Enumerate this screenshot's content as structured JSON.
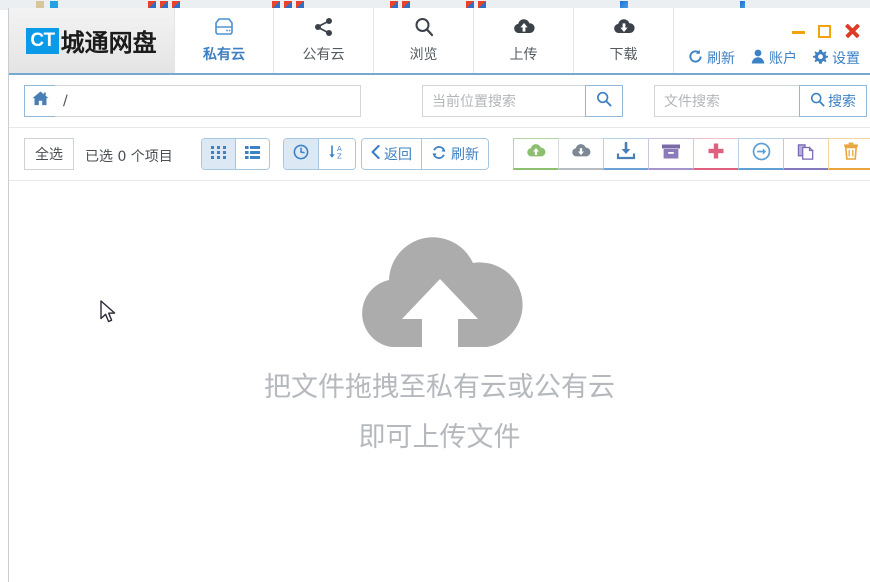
{
  "window": {
    "brand": {
      "badge": "CT",
      "name": "城通网盘"
    },
    "controls": {
      "minimize": "minimize-button",
      "maximize": "maximize-button",
      "close": "close-button"
    },
    "links": [
      {
        "label": "刷新",
        "icon": "refresh-icon"
      },
      {
        "label": "账户",
        "icon": "user-icon"
      },
      {
        "label": "设置",
        "icon": "gear-icon"
      }
    ]
  },
  "tabs": [
    {
      "label": "私有云",
      "icon": "hard-drive-icon",
      "active": true
    },
    {
      "label": "公有云",
      "icon": "share-icon",
      "active": false
    },
    {
      "label": "浏览",
      "icon": "search-icon",
      "active": false
    },
    {
      "label": "上传",
      "icon": "cloud-upload-icon",
      "active": false
    },
    {
      "label": "下载",
      "icon": "cloud-download-icon",
      "active": false
    }
  ],
  "address": {
    "home_icon": "home-icon",
    "path_value": "/",
    "location_search": {
      "placeholder": "当前位置搜索",
      "button_label": "",
      "button_icon": "search-icon"
    },
    "file_search": {
      "placeholder": "文件搜索",
      "button_label": "搜索",
      "button_icon": "search-icon"
    }
  },
  "toolbar": {
    "select_all_label": "全选",
    "selected_count_text": "已选 0 个项目",
    "view_buttons": [
      {
        "name": "grid-view",
        "icon": "grid-icon",
        "active": true
      },
      {
        "name": "list-view",
        "icon": "list-icon",
        "active": false
      }
    ],
    "sort_buttons": [
      {
        "name": "sort-by-time",
        "icon": "clock-icon",
        "active": true
      },
      {
        "name": "sort-alphabetical",
        "icon": "sort-az-icon",
        "active": false
      }
    ],
    "nav_buttons": [
      {
        "label": "返回",
        "icon": "chevron-left-icon"
      },
      {
        "label": "刷新",
        "icon": "refresh-icon"
      }
    ],
    "actions": [
      {
        "name": "upload-to-cloud",
        "icon": "cloud-upload-icon",
        "color": "#8cbf6e"
      },
      {
        "name": "download-from-cloud",
        "icon": "cloud-download-icon",
        "color": "#7c8894"
      },
      {
        "name": "save-to-disk",
        "icon": "download-tray-icon",
        "color": "#6ba3d6"
      },
      {
        "name": "archive",
        "icon": "box-icon",
        "color": "#8c7bb8"
      },
      {
        "name": "new-folder",
        "icon": "plus-icon",
        "color": "#e0607f"
      },
      {
        "name": "move",
        "icon": "arrow-right-circle-icon",
        "color": "#5f9fd4"
      },
      {
        "name": "copy",
        "icon": "copy-icon",
        "color": "#8478bf"
      },
      {
        "name": "delete",
        "icon": "trash-icon",
        "color": "#e8a63c"
      }
    ]
  },
  "content": {
    "empty_icon": "cloud-upload-large-icon",
    "empty_line1": "把文件拖拽至私有云或公有云",
    "empty_line2": "即可上传文件"
  },
  "colors": {
    "accent_blue": "#3d82c4",
    "header_border": "#74aacd",
    "logo_blue": "#0b9ae8",
    "placeholder_gray": "#b2b6ba",
    "empty_gray": "#b0b4b8"
  }
}
